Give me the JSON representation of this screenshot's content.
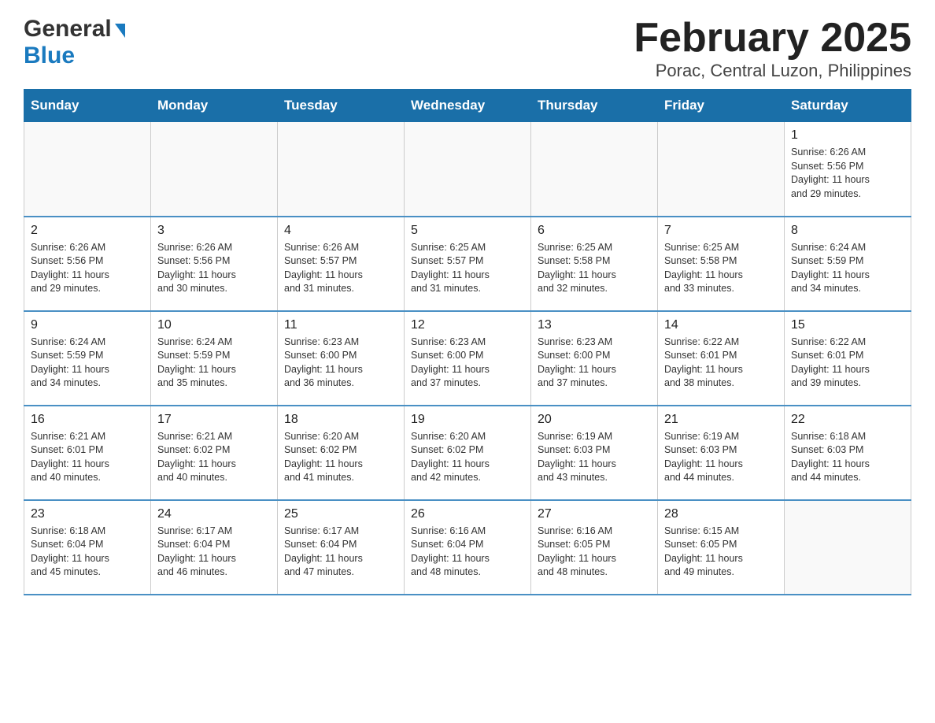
{
  "header": {
    "logo": {
      "general": "General",
      "blue": "Blue"
    },
    "title": "February 2025",
    "location": "Porac, Central Luzon, Philippines"
  },
  "weekdays": [
    "Sunday",
    "Monday",
    "Tuesday",
    "Wednesday",
    "Thursday",
    "Friday",
    "Saturday"
  ],
  "weeks": [
    {
      "days": [
        {
          "number": "",
          "info": ""
        },
        {
          "number": "",
          "info": ""
        },
        {
          "number": "",
          "info": ""
        },
        {
          "number": "",
          "info": ""
        },
        {
          "number": "",
          "info": ""
        },
        {
          "number": "",
          "info": ""
        },
        {
          "number": "1",
          "info": "Sunrise: 6:26 AM\nSunset: 5:56 PM\nDaylight: 11 hours\nand 29 minutes."
        }
      ]
    },
    {
      "days": [
        {
          "number": "2",
          "info": "Sunrise: 6:26 AM\nSunset: 5:56 PM\nDaylight: 11 hours\nand 29 minutes."
        },
        {
          "number": "3",
          "info": "Sunrise: 6:26 AM\nSunset: 5:56 PM\nDaylight: 11 hours\nand 30 minutes."
        },
        {
          "number": "4",
          "info": "Sunrise: 6:26 AM\nSunset: 5:57 PM\nDaylight: 11 hours\nand 31 minutes."
        },
        {
          "number": "5",
          "info": "Sunrise: 6:25 AM\nSunset: 5:57 PM\nDaylight: 11 hours\nand 31 minutes."
        },
        {
          "number": "6",
          "info": "Sunrise: 6:25 AM\nSunset: 5:58 PM\nDaylight: 11 hours\nand 32 minutes."
        },
        {
          "number": "7",
          "info": "Sunrise: 6:25 AM\nSunset: 5:58 PM\nDaylight: 11 hours\nand 33 minutes."
        },
        {
          "number": "8",
          "info": "Sunrise: 6:24 AM\nSunset: 5:59 PM\nDaylight: 11 hours\nand 34 minutes."
        }
      ]
    },
    {
      "days": [
        {
          "number": "9",
          "info": "Sunrise: 6:24 AM\nSunset: 5:59 PM\nDaylight: 11 hours\nand 34 minutes."
        },
        {
          "number": "10",
          "info": "Sunrise: 6:24 AM\nSunset: 5:59 PM\nDaylight: 11 hours\nand 35 minutes."
        },
        {
          "number": "11",
          "info": "Sunrise: 6:23 AM\nSunset: 6:00 PM\nDaylight: 11 hours\nand 36 minutes."
        },
        {
          "number": "12",
          "info": "Sunrise: 6:23 AM\nSunset: 6:00 PM\nDaylight: 11 hours\nand 37 minutes."
        },
        {
          "number": "13",
          "info": "Sunrise: 6:23 AM\nSunset: 6:00 PM\nDaylight: 11 hours\nand 37 minutes."
        },
        {
          "number": "14",
          "info": "Sunrise: 6:22 AM\nSunset: 6:01 PM\nDaylight: 11 hours\nand 38 minutes."
        },
        {
          "number": "15",
          "info": "Sunrise: 6:22 AM\nSunset: 6:01 PM\nDaylight: 11 hours\nand 39 minutes."
        }
      ]
    },
    {
      "days": [
        {
          "number": "16",
          "info": "Sunrise: 6:21 AM\nSunset: 6:01 PM\nDaylight: 11 hours\nand 40 minutes."
        },
        {
          "number": "17",
          "info": "Sunrise: 6:21 AM\nSunset: 6:02 PM\nDaylight: 11 hours\nand 40 minutes."
        },
        {
          "number": "18",
          "info": "Sunrise: 6:20 AM\nSunset: 6:02 PM\nDaylight: 11 hours\nand 41 minutes."
        },
        {
          "number": "19",
          "info": "Sunrise: 6:20 AM\nSunset: 6:02 PM\nDaylight: 11 hours\nand 42 minutes."
        },
        {
          "number": "20",
          "info": "Sunrise: 6:19 AM\nSunset: 6:03 PM\nDaylight: 11 hours\nand 43 minutes."
        },
        {
          "number": "21",
          "info": "Sunrise: 6:19 AM\nSunset: 6:03 PM\nDaylight: 11 hours\nand 44 minutes."
        },
        {
          "number": "22",
          "info": "Sunrise: 6:18 AM\nSunset: 6:03 PM\nDaylight: 11 hours\nand 44 minutes."
        }
      ]
    },
    {
      "days": [
        {
          "number": "23",
          "info": "Sunrise: 6:18 AM\nSunset: 6:04 PM\nDaylight: 11 hours\nand 45 minutes."
        },
        {
          "number": "24",
          "info": "Sunrise: 6:17 AM\nSunset: 6:04 PM\nDaylight: 11 hours\nand 46 minutes."
        },
        {
          "number": "25",
          "info": "Sunrise: 6:17 AM\nSunset: 6:04 PM\nDaylight: 11 hours\nand 47 minutes."
        },
        {
          "number": "26",
          "info": "Sunrise: 6:16 AM\nSunset: 6:04 PM\nDaylight: 11 hours\nand 48 minutes."
        },
        {
          "number": "27",
          "info": "Sunrise: 6:16 AM\nSunset: 6:05 PM\nDaylight: 11 hours\nand 48 minutes."
        },
        {
          "number": "28",
          "info": "Sunrise: 6:15 AM\nSunset: 6:05 PM\nDaylight: 11 hours\nand 49 minutes."
        },
        {
          "number": "",
          "info": ""
        }
      ]
    }
  ]
}
